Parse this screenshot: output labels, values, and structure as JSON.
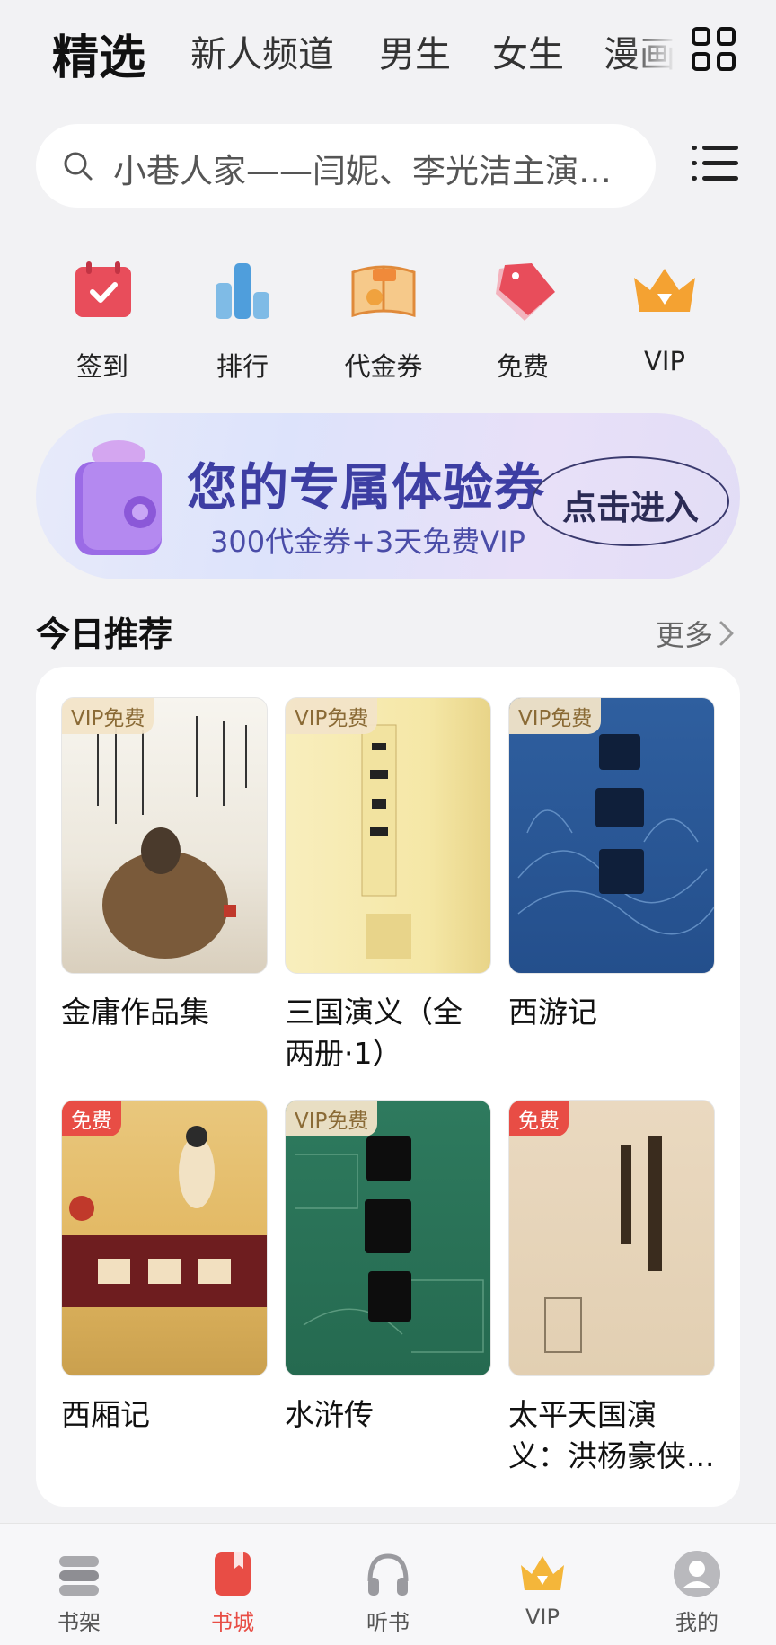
{
  "top_tabs": [
    "精选",
    "新人频道",
    "男生",
    "女生",
    "漫画"
  ],
  "search": {
    "placeholder": "小巷人家——闫妮、李光洁主演的热播剧原著"
  },
  "quick_entries": [
    {
      "label": "签到",
      "icon": "calendar-check-icon"
    },
    {
      "label": "排行",
      "icon": "bar-chart-icon"
    },
    {
      "label": "代金券",
      "icon": "coupon-book-icon"
    },
    {
      "label": "免费",
      "icon": "free-tag-icon"
    },
    {
      "label": "VIP",
      "icon": "crown-icon"
    }
  ],
  "banner": {
    "title": "您的专属体验券",
    "subtitle": "300代金券+3天免费VIP",
    "cta": "点击进入"
  },
  "recommend": {
    "title": "今日推荐",
    "more": "更多",
    "books": [
      {
        "title": "金庸作品集",
        "badge": "VIP免费"
      },
      {
        "title": "三国演义（全两册·1）",
        "badge": "VIP免费"
      },
      {
        "title": "西游记",
        "badge": "VIP免费"
      },
      {
        "title": "西厢记",
        "badge": "免费"
      },
      {
        "title": "水浒传",
        "badge": "VIP免费"
      },
      {
        "title": "太平天国演义：洪杨豪侠...",
        "badge": "免费"
      }
    ]
  },
  "bottom_nav": [
    {
      "label": "书架",
      "icon": "bookshelf-icon"
    },
    {
      "label": "书城",
      "icon": "bookstore-icon"
    },
    {
      "label": "听书",
      "icon": "headphones-icon"
    },
    {
      "label": "VIP",
      "icon": "vip-crown-icon"
    },
    {
      "label": "我的",
      "icon": "profile-avatar-icon"
    }
  ],
  "colors": {
    "accent": "#e84d45",
    "banner_text": "#3d3ea3",
    "vip_gold": "#f0a02a"
  }
}
